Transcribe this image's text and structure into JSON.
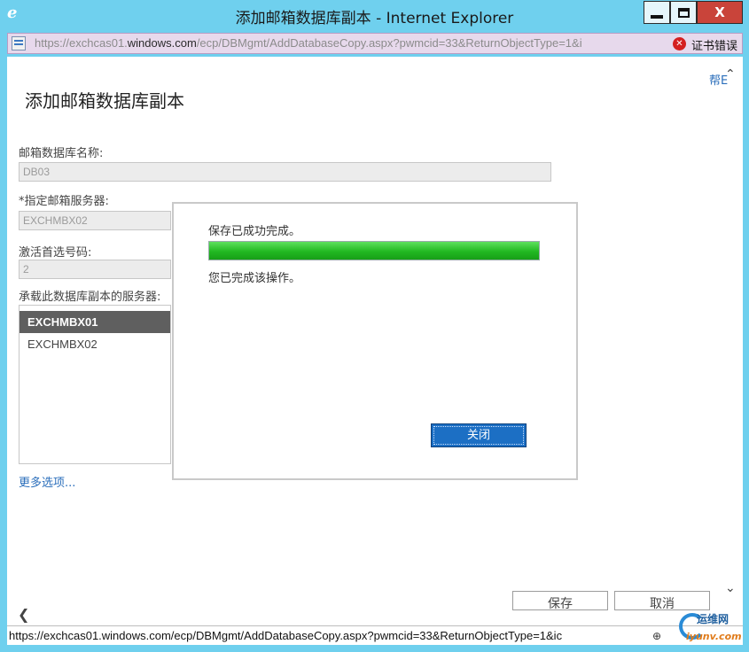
{
  "window": {
    "title": "添加邮箱数据库副本 - Internet Explorer",
    "minimize_label": "",
    "maximize_label": "",
    "close_label": "X"
  },
  "address": {
    "url_prefix": "https://exchcas01.",
    "url_domain": "windows.com",
    "url_rest": "/ecp/DBMgmt/AddDatabaseCopy.aspx?pwmcid=33&ReturnObjectType=1&i",
    "cert_error": "证书错误"
  },
  "page": {
    "help": "帮E",
    "title": "添加邮箱数据库副本",
    "db_name_label": "邮箱数据库名称:",
    "db_name_value": "DB03",
    "server_label": "*指定邮箱服务器:",
    "server_value": "EXCHMBX02",
    "activation_label": "激活首选号码:",
    "activation_value": "2",
    "servers_list_label": "承载此数据库副本的服务器:",
    "servers": [
      "EXCHMBX01",
      "EXCHMBX02"
    ],
    "more_options": "更多选项...",
    "save_button": "保存",
    "cancel_button": "取消"
  },
  "dialog": {
    "message": "保存已成功完成。",
    "progress": 100,
    "sub_message": "您已完成该操作。",
    "close_button": "关闭"
  },
  "status": {
    "url": "https://exchcas01.windows.com/ecp/DBMgmt/AddDatabaseCopy.aspx?pwmcid=33&ReturnObjectType=1&ic"
  },
  "watermark": {
    "cn": "运维网",
    "en": "iyunv.com"
  },
  "colors": {
    "titlebar": "#6fd0ee",
    "accent_button": "#1c6fc4",
    "progress": "#22b822",
    "close_button": "#c9443a"
  }
}
